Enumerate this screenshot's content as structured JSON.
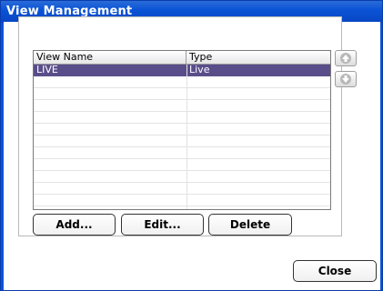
{
  "window": {
    "title": "View Management"
  },
  "list": {
    "columns": [
      "View Name",
      "Type"
    ],
    "rows": [
      {
        "name": "LIVE",
        "type": "Live",
        "selected": true
      }
    ],
    "selection_color": "#5a4e8a"
  },
  "buttons": {
    "add": "Add...",
    "edit": "Edit...",
    "delete": "Delete",
    "close": "Close"
  },
  "icons": {
    "move_up": "arrow-up-icon",
    "move_down": "arrow-down-icon"
  }
}
